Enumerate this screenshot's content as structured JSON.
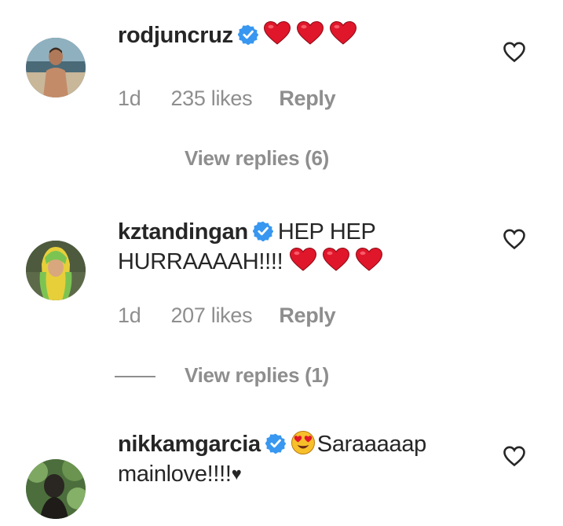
{
  "comments": [
    {
      "username": "rodjuncruz",
      "text_line1": "",
      "text_line2": "",
      "time": "1d",
      "likes": "235 likes",
      "reply": "Reply",
      "view_replies": "View replies (6)",
      "icons": [
        "verified-badge-icon",
        "red-heart-emoji",
        "like-heart-outline-icon"
      ]
    },
    {
      "username": "kztandingan",
      "text_line1": "HEP HEP",
      "text_line2": "HURRAAAAH!!!!",
      "time": "1d",
      "likes": "207 likes",
      "reply": "Reply",
      "view_replies": "View replies (1)",
      "icons": [
        "verified-badge-icon",
        "red-heart-emoji",
        "like-heart-outline-icon"
      ]
    },
    {
      "username": "nikkamgarcia",
      "text_line1": "Saraaaaap",
      "text_line2": "mainlove!!!!",
      "trailing_symbol": "♥",
      "icons": [
        "verified-badge-icon",
        "heart-eyes-emoji",
        "like-heart-outline-icon"
      ]
    }
  ],
  "colors": {
    "verified_blue": "#3897f0",
    "heart_red": "#e0162b",
    "meta_gray": "#8e8e8e",
    "text": "#262626"
  }
}
